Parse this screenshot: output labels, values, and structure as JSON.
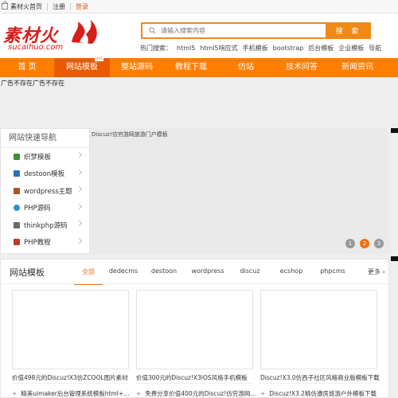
{
  "topbar": {
    "home": "素材火首页",
    "register": "注册",
    "login": "登录"
  },
  "logo": {
    "main": "素材火",
    "sub": "sucaihuo.com"
  },
  "search": {
    "placeholder": "请输入搜索内容",
    "button": "搜 索"
  },
  "hot_search": {
    "label": "热门搜索：",
    "terms": [
      "html5",
      "html5响应式",
      "手机模板",
      "bootstrap",
      "后台模板",
      "企业模板",
      "导航"
    ]
  },
  "nav": {
    "items": [
      {
        "label": "首 页"
      },
      {
        "label": "网站模板"
      },
      {
        "label": "整站源码"
      },
      {
        "label": "教程下载"
      },
      {
        "label": "仿站"
      },
      {
        "label": "技术问答"
      },
      {
        "label": "新闻资讯"
      }
    ],
    "hot_badge": "HOT"
  },
  "ad_text": "广告不存在广告不存在",
  "banner": {
    "caption": "Discuz!仿穷游网旅游门户模板"
  },
  "quicknav": {
    "title": "网站快速导航",
    "items": [
      {
        "label": "织梦模板",
        "icon": "monitor-icon",
        "color": "#3a8f3a"
      },
      {
        "label": "destoon模板",
        "icon": "monitor-icon",
        "color": "#2f6fbf"
      },
      {
        "label": "wordpress主题",
        "icon": "book-icon",
        "color": "#b0522b"
      },
      {
        "label": "PHP源码",
        "icon": "globe-icon",
        "color": "#2f8fd8"
      },
      {
        "label": "thinkphp源码",
        "icon": "pen-icon",
        "color": "#6a6a6a"
      },
      {
        "label": "PHP教程",
        "icon": "book-icon",
        "color": "#c0392b"
      }
    ]
  },
  "pager": [
    "1",
    "2",
    "3"
  ],
  "section": {
    "title": "网站模板",
    "tabs": [
      "全部",
      "dedecms",
      "destoon",
      "wordpress",
      "discuz",
      "ecshop",
      "phpcms"
    ],
    "more": "更多"
  },
  "cards": [
    {
      "caption": "价值498元的Discuz!X3仿ZCOOL图片素材",
      "link": "精美uimaker后台管理系统模板html+..."
    },
    {
      "caption": "价值300元的Discuz!X3IOS风格手机模板",
      "link": "免费分享价值400元的Discuz!仿穷游网..."
    },
    {
      "caption": "Discuz!X3.0仿西子社区风格商业版模板下载",
      "link": "Discuz!X3.2精仿遵房旅游户外模板下载"
    }
  ],
  "colors": {
    "accent": "#ff7e00",
    "accent_dark": "#e85b00",
    "brand_red": "#d71f1a"
  }
}
